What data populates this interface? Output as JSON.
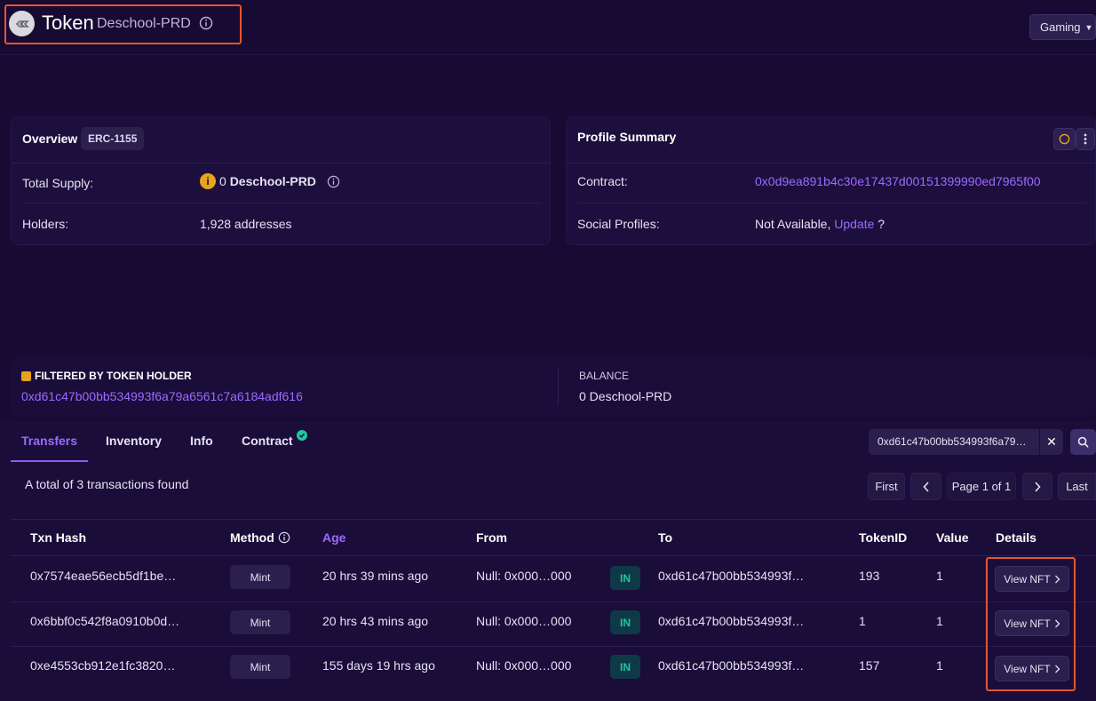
{
  "header": {
    "title": "Token",
    "subtitle": "Deschool-PRD",
    "category_select": "Gaming"
  },
  "overview": {
    "title": "Overview",
    "standard_badge": "ERC-1155",
    "total_supply_label": "Total Supply:",
    "total_supply_value": "0",
    "total_supply_unit": "Deschool-PRD",
    "holders_label": "Holders:",
    "holders_value": "1,928 addresses"
  },
  "profile_summary": {
    "title": "Profile Summary",
    "contract_label": "Contract:",
    "contract_value": "0x0d9ea891b4c30e17437d00151399990ed7965f00",
    "social_label": "Social Profiles:",
    "social_value": "Not Available,",
    "social_update_link": "Update",
    "social_suffix": "?"
  },
  "filter": {
    "heading": "FILTERED BY TOKEN HOLDER",
    "address": "0xd61c47b00bb534993f6a79a6561c7a6184adf616",
    "balance_label": "BALANCE",
    "balance_value": "0 Deschool-PRD"
  },
  "tabs": [
    {
      "label": "Transfers",
      "active": true
    },
    {
      "label": "Inventory",
      "active": false
    },
    {
      "label": "Info",
      "active": false
    },
    {
      "label": "Contract",
      "active": false
    }
  ],
  "search": {
    "value": "0xd61c47b00bb534993f6a79…"
  },
  "summary_text": "A total of 3 transactions found",
  "pagination": {
    "first": "First",
    "page": "Page 1 of 1",
    "last": "Last"
  },
  "table": {
    "headers": [
      "Txn Hash",
      "Method",
      "Age",
      "From",
      "To",
      "TokenID",
      "Value",
      "Details"
    ],
    "rows": [
      {
        "hash": "0x7574eae56ecb5df1be…",
        "method": "Mint",
        "age": "20 hrs 39 mins ago",
        "from": "Null: 0x000…000",
        "direction": "IN",
        "to": "0xd61c47b00bb534993f…",
        "token_id": "193",
        "value": "1",
        "details": "View NFT"
      },
      {
        "hash": "0x6bbf0c542f8a0910b0d…",
        "method": "Mint",
        "age": "20 hrs 43 mins ago",
        "from": "Null: 0x000…000",
        "direction": "IN",
        "to": "0xd61c47b00bb534993f…",
        "token_id": "1",
        "value": "1",
        "details": "View NFT"
      },
      {
        "hash": "0xe4553cb912e1fc3820…",
        "method": "Mint",
        "age": "155 days 19 hrs ago",
        "from": "Null: 0x000…000",
        "direction": "IN",
        "to": "0xd61c47b00bb534993f…",
        "token_id": "157",
        "value": "1",
        "details": "View NFT"
      }
    ]
  },
  "colors": {
    "background": "#170a33",
    "card": "#1c0f3d",
    "accent": "#9b6bff",
    "highlight": "#e8542a",
    "in_badge": "#1fc7a0",
    "warning": "#e8a21c"
  }
}
